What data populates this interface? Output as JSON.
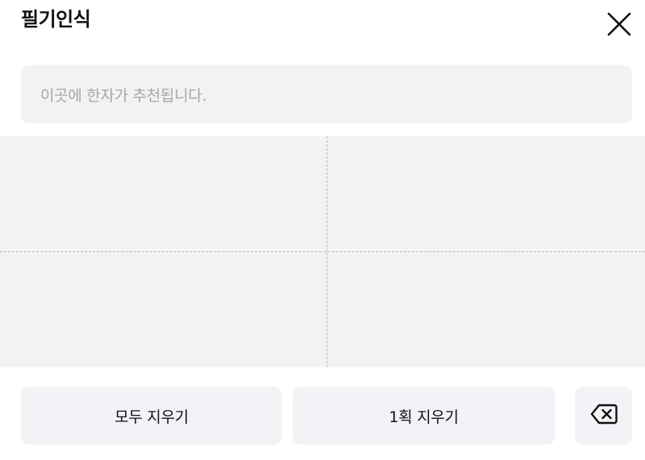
{
  "header": {
    "title": "필기인식",
    "close_icon": "close-icon"
  },
  "suggestions": {
    "placeholder": "이곳에 한자가 추천됩니다."
  },
  "canvas": {
    "background": "#f3f3f3",
    "guide_color": "#b4b4b4"
  },
  "actions": {
    "clear_all_label": "모두 지우기",
    "undo_stroke_label": "1획 지우기",
    "backspace_icon": "backspace-icon"
  }
}
